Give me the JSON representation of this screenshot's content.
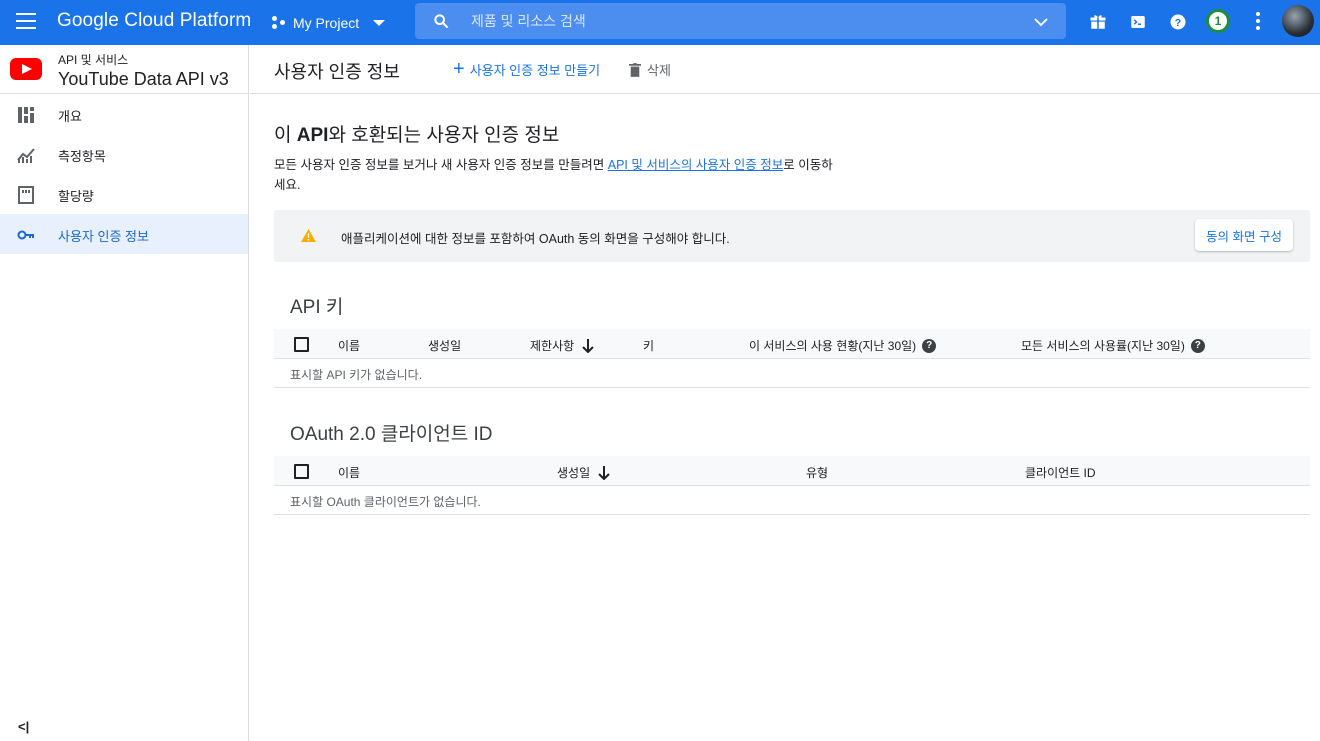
{
  "topbar": {
    "brand": "Google Cloud Platform",
    "project": "My Project",
    "search_placeholder": "제품 및 리소스 검색",
    "notification_count": "1",
    "icons": [
      "menu-icon",
      "project-dots-icon",
      "search-icon",
      "chevron-down-icon",
      "gift-icon",
      "cloud-shell-icon",
      "help-icon",
      "more-vert-icon"
    ]
  },
  "sidebar": {
    "api_subtitle": "API 및 서비스",
    "api_title": "YouTube Data API v3",
    "items": [
      {
        "label": "개요",
        "icon": "dashboard-icon"
      },
      {
        "label": "측정항목",
        "icon": "metrics-icon"
      },
      {
        "label": "할당량",
        "icon": "quota-icon"
      },
      {
        "label": "사용자 인증 정보",
        "icon": "key-icon"
      }
    ],
    "collapse_label": "<|"
  },
  "header": {
    "title": "사용자 인증 정보",
    "create_label": "사용자 인증 정보 만들기",
    "delete_label": "삭제"
  },
  "content": {
    "section_title_prefix": "이 ",
    "section_title_bold": "API",
    "section_title_suffix": "와 호환되는 사용자 인증 정보",
    "desc_before": "모든 사용자 인증 정보를 보거나 새 사용자 인증 정보를 만들려면 ",
    "desc_link": "API 및 서비스의 사용자 인증 정보",
    "desc_after": "로 이동하세요.",
    "alert_text": "애플리케이션에 대한 정보를 포함하여 OAuth 동의 화면을 구성해야 합니다.",
    "alert_button": "동의 화면 구성"
  },
  "api_keys": {
    "title": "API 키",
    "columns": [
      "이름",
      "생성일",
      "제한사항",
      "키",
      "이 서비스의 사용 현황(지난 30일)",
      "모든 서비스의 사용률(지난 30일)"
    ],
    "empty": "표시할 API 키가 없습니다."
  },
  "oauth": {
    "title": "OAuth 2.0 클라이언트 ID",
    "columns": [
      "이름",
      "생성일",
      "유형",
      "클라이언트 ID"
    ],
    "empty": "표시할 OAuth 클라이언트가 없습니다."
  },
  "colors": {
    "primary": "#1a73e8",
    "active_bg": "#e8f0fe",
    "warning": "#f9ab00",
    "youtube": "#ff0000"
  }
}
